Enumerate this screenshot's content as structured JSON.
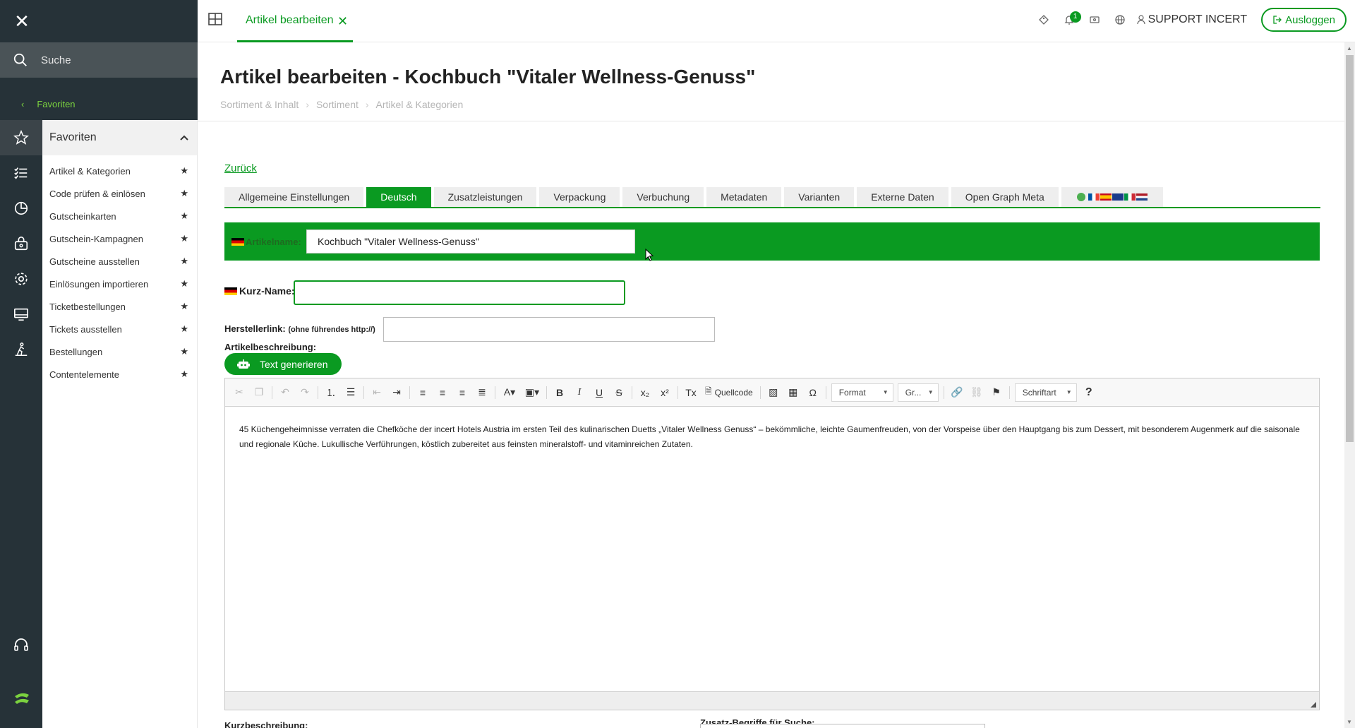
{
  "search": {
    "placeholder": "Suche"
  },
  "nav": {
    "favorites_back": "Favoriten",
    "panel_title": "Favoriten",
    "items": [
      {
        "label": "Artikel & Kategorien"
      },
      {
        "label": "Code prüfen & einlösen"
      },
      {
        "label": "Gutscheinkarten"
      },
      {
        "label": "Gutschein-Kampagnen"
      },
      {
        "label": "Gutscheine ausstellen"
      },
      {
        "label": "Einlösungen importieren"
      },
      {
        "label": "Ticketbestellungen"
      },
      {
        "label": "Tickets ausstellen"
      },
      {
        "label": "Bestellungen"
      },
      {
        "label": "Contentelemente"
      }
    ],
    "rail_icons": [
      "star-icon",
      "checklist-icon",
      "chart-icon",
      "shop-icon",
      "gear-icon",
      "monitor-icon",
      "hiking-icon"
    ]
  },
  "topbar": {
    "tab_label": "Artikel bearbeiten",
    "notification_count": "1",
    "user": "SUPPORT INCERT",
    "logout": "Ausloggen"
  },
  "page": {
    "title": "Artikel bearbeiten - Kochbuch \"Vitaler Wellness-Genuss\"",
    "breadcrumb": [
      "Sortiment & Inhalt",
      "Sortiment",
      "Artikel & Kategorien"
    ],
    "back": "Zurück"
  },
  "tabs": [
    "Allgemeine Einstellungen",
    "Deutsch",
    "Zusatzleistungen",
    "Verpackung",
    "Verbuchung",
    "Metadaten",
    "Varianten",
    "Externe Daten",
    "Open Graph Meta"
  ],
  "form": {
    "article_name_label": "Artikelname:",
    "article_name_value": "Kochbuch \"Vitaler Wellness-Genuss\"",
    "short_name_label": "Kurz-Name:",
    "short_name_value": "",
    "manufacturer_label": "Herstellerlink:",
    "manufacturer_hint": "(ohne führendes http://)",
    "manufacturer_value": "",
    "description_label": "Artikelbeschreibung:",
    "generate_button": "Text generieren",
    "short_description_label": "Kurzbeschreibung:",
    "search_terms_label": "Zusatz-Begriffe für Suche:"
  },
  "editor": {
    "source_label": "Quellcode",
    "format_combo": "Format",
    "size_combo": "Gr...",
    "font_combo": "Schriftart",
    "content": "45 Küchengeheimnisse verraten die Chefköche der incert Hotels Austria im ersten Teil des kulinarischen Duetts „Vitaler Wellness Genuss“ – bekömmliche, leichte Gaumenfreuden, von der Vorspeise über den Hauptgang bis zum Dessert, mit besonderem Augenmerk auf die saisonale und regionale Küche. Lukullische Verführungen, köstlich zubereitet aus feinsten mineralstoff- und vitaminreichen Zutaten."
  },
  "colors": {
    "accent": "#0a9a21",
    "rail": "#263238",
    "highlight": "#7bd23f"
  }
}
